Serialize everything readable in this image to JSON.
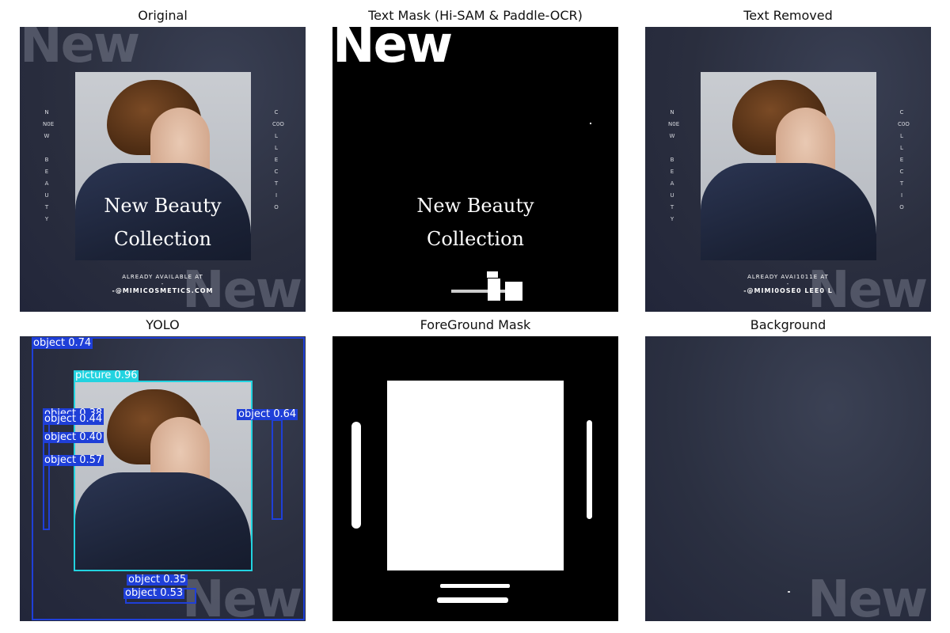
{
  "panels": {
    "original": "Original",
    "text_mask": "Text Mask (Hi-SAM & Paddle-OCR)",
    "text_removed": "Text Removed",
    "yolo": "YOLO",
    "foreground": "ForeGround Mask",
    "background": "Background"
  },
  "poster": {
    "big_word": "New",
    "headline_1": "New Beauty",
    "headline_2": "Collection",
    "available": "ALREADY AVAILABLE AT",
    "dash": "-",
    "site": "-@MIMICOSMETICS.COM",
    "left_vertical": [
      "N",
      "N0E",
      "W",
      "",
      "B",
      "E",
      "A",
      "U",
      "T",
      "Y"
    ],
    "right_vertical": [
      "C",
      "C0O",
      "L",
      "L",
      "E",
      "C",
      "T",
      "I",
      "O"
    ]
  },
  "text_removed": {
    "available": "ALREADY AVAI1011E AT",
    "site": "-@MIMI0OSE0 LEE0 L"
  },
  "yolo": {
    "labels": [
      {
        "text": "object 0.74",
        "color": "#1f3fd8"
      },
      {
        "text": "picture 0.96",
        "color": "#22d3e0"
      },
      {
        "text": "object 0.38",
        "color": "#1f3fd8"
      },
      {
        "text": "object 0.44",
        "color": "#1f3fd8"
      },
      {
        "text": "object 0.40",
        "color": "#1f3fd8"
      },
      {
        "text": "object 0.57",
        "color": "#1f3fd8"
      },
      {
        "text": "object 0.64",
        "color": "#1f3fd8"
      },
      {
        "text": "object 0.35",
        "color": "#1f3fd8"
      },
      {
        "text": "object 0.53",
        "color": "#1f3fd8"
      }
    ]
  }
}
